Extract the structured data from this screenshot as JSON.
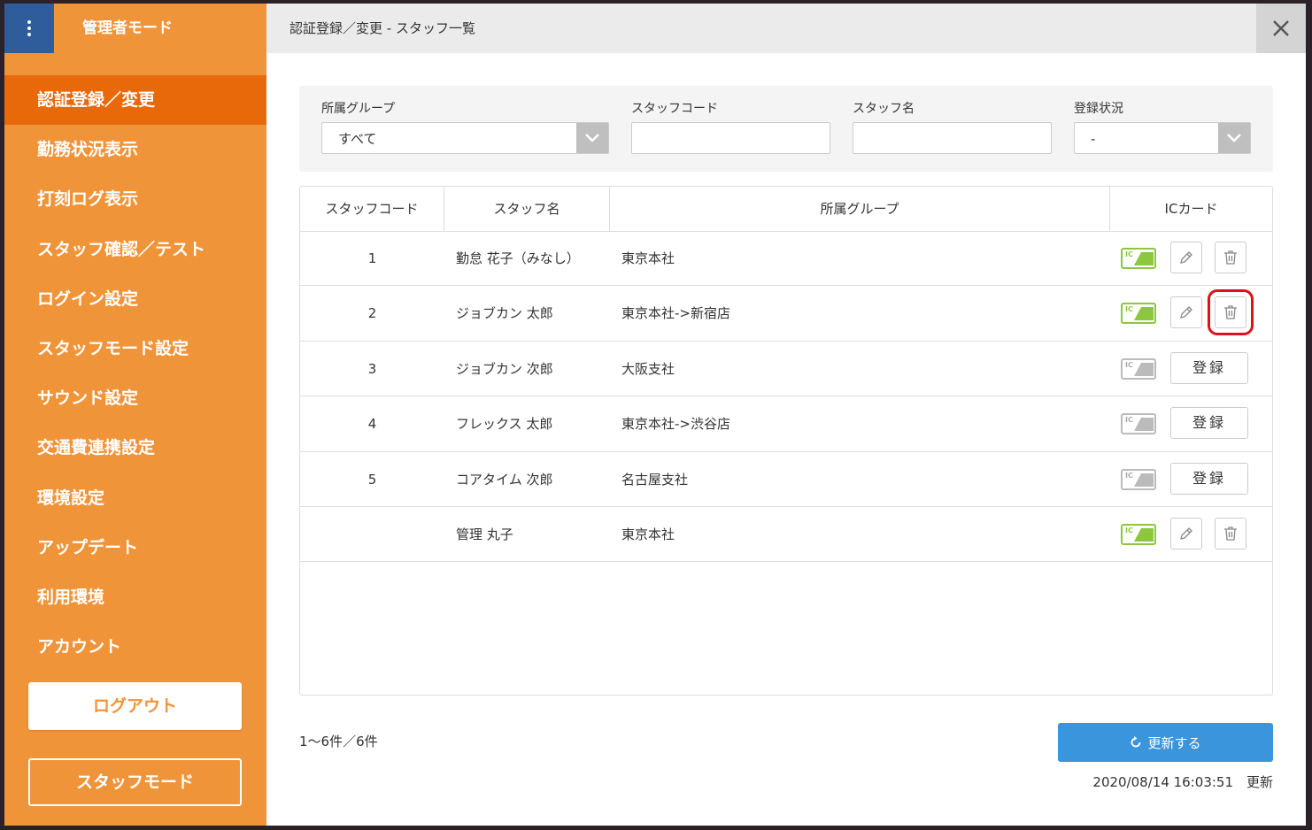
{
  "sidebar": {
    "title": "管理者モード",
    "items": [
      {
        "label": "認証登録／変更",
        "active": true
      },
      {
        "label": "勤務状況表示"
      },
      {
        "label": "打刻ログ表示"
      },
      {
        "label": "スタッフ確認／テスト"
      },
      {
        "label": "ログイン設定"
      },
      {
        "label": "スタッフモード設定"
      },
      {
        "label": "サウンド設定"
      },
      {
        "label": "交通費連携設定"
      },
      {
        "label": "環境設定"
      },
      {
        "label": "アップデート"
      },
      {
        "label": "利用環境"
      },
      {
        "label": "アカウント"
      }
    ],
    "logout_label": "ログアウト",
    "staff_mode_label": "スタッフモード"
  },
  "header": {
    "title": "認証登録／変更 - スタッフ一覧"
  },
  "filters": {
    "group_label": "所属グループ",
    "group_value": "すべて",
    "code_label": "スタッフコード",
    "code_value": "",
    "name_label": "スタッフ名",
    "name_value": "",
    "status_label": "登録状況",
    "status_value": "-"
  },
  "table": {
    "headers": [
      "スタッフコード",
      "スタッフ名",
      "所属グループ",
      "ICカード"
    ],
    "rows": [
      {
        "code": "1",
        "name": "勤怠 花子（みなし）",
        "group": "東京本社",
        "ic_registered": true
      },
      {
        "code": "2",
        "name": "ジョブカン 太郎",
        "group": "東京本社->新宿店",
        "ic_registered": true
      },
      {
        "code": "3",
        "name": "ジョブカン 次郎",
        "group": "大阪支社",
        "ic_registered": false
      },
      {
        "code": "4",
        "name": "フレックス 太郎",
        "group": "東京本社->渋谷店",
        "ic_registered": false
      },
      {
        "code": "5",
        "name": "コアタイム 次郎",
        "group": "名古屋支社",
        "ic_registered": false
      },
      {
        "code": "",
        "name": "管理 丸子",
        "group": "東京本社",
        "ic_registered": true
      }
    ],
    "ic_label": "IC",
    "register_label": "登録"
  },
  "footer": {
    "count": "1〜6件／6件",
    "refresh_label": "更新する",
    "updated": "2020/08/14 16:03:51　更新"
  },
  "colors": {
    "sidebar": "#f0943a",
    "sidebar_active": "#e8690a",
    "menu_button": "#2f5c9a",
    "ic_green": "#8dc63f",
    "refresh_button": "#3a95dd",
    "highlight": "#e0101b"
  }
}
